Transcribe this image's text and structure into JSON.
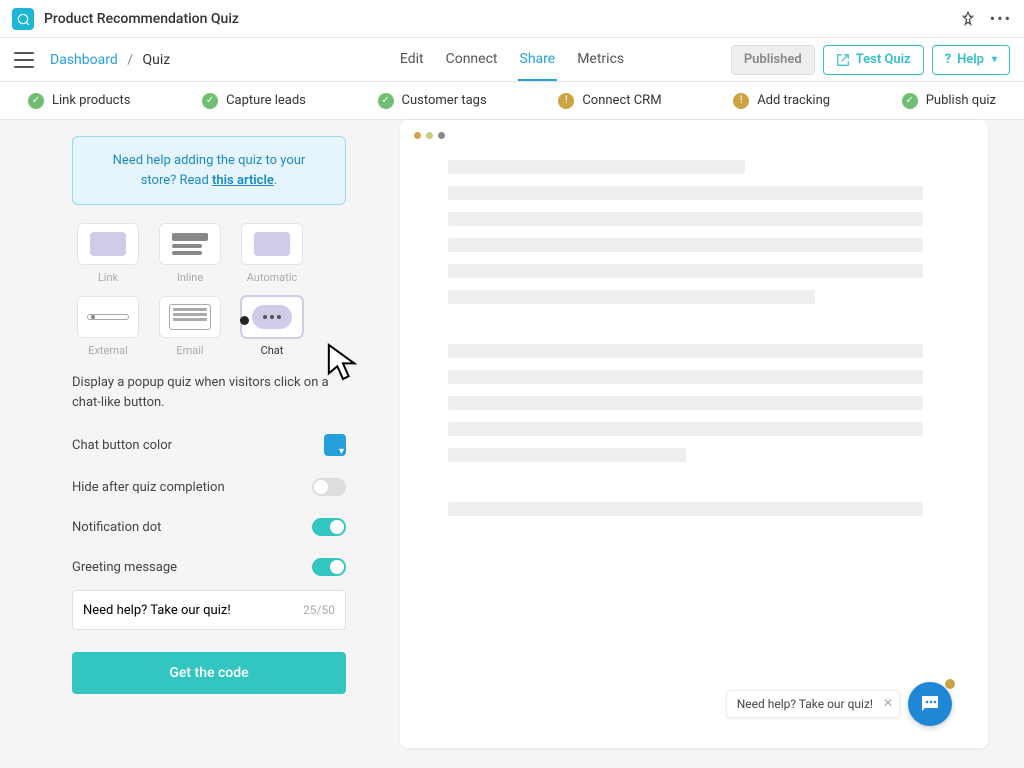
{
  "app": {
    "title": "Product Recommendation Quiz"
  },
  "crumb": {
    "root": "Dashboard",
    "sep": "/",
    "current": "Quiz"
  },
  "tabs": {
    "edit": "Edit",
    "connect": "Connect",
    "share": "Share",
    "metrics": "Metrics"
  },
  "actions": {
    "published": "Published",
    "test": "Test Quiz",
    "help": "Help"
  },
  "steps": {
    "link": "Link products",
    "leads": "Capture leads",
    "tags": "Customer tags",
    "crm": "Connect CRM",
    "tracking": "Add tracking",
    "publish": "Publish quiz"
  },
  "helpbox": {
    "line": "Need help adding the quiz to your store? Read ",
    "link": "this article",
    "tail": "."
  },
  "shareOptions": {
    "link": "Link",
    "inline": "Inline",
    "automatic": "Automatic",
    "external": "External",
    "email": "Email",
    "chat": "Chat"
  },
  "chatDesc": "Display a popup quiz when visitors click on a chat-like button.",
  "controls": {
    "color": "Chat button color",
    "hide": "Hide after quiz completion",
    "dot": "Notification dot",
    "greeting": "Greeting message"
  },
  "greetingInput": {
    "value": "Need help? Take our quiz!",
    "counter": "25/50"
  },
  "getCode": "Get the code",
  "preview": {
    "bubble": "Need help? Take our quiz!"
  },
  "colors": {
    "accent": "#33c6c0",
    "link": "#269fdb",
    "chatFab": "#2086d6"
  }
}
